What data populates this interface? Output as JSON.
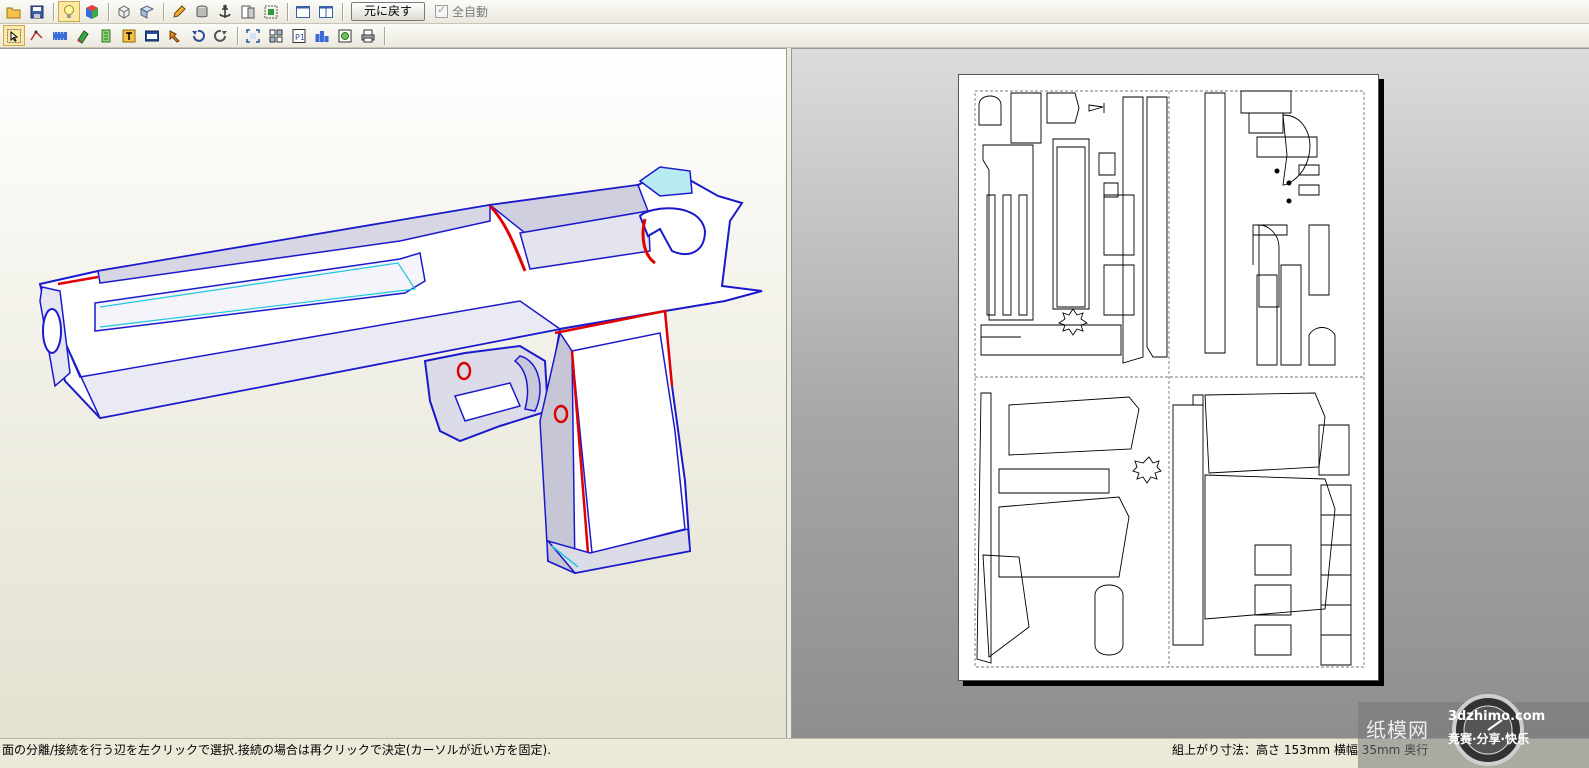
{
  "toolbar_top": {
    "icons": [
      "open-folder-icon",
      "save-disk-icon",
      "lightbulb-icon",
      "color-cube-icon",
      "cube-outline-icon",
      "cube-flat-icon",
      "pencil-icon",
      "cylinder-icon",
      "anchor-icon",
      "page-split-icon",
      "green-box-icon",
      "single-pane-icon",
      "dual-pane-icon"
    ],
    "undo_label": "元に戻す",
    "auto_label": "全自動",
    "auto_checked": true
  },
  "toolbar_bottom": {
    "icons": [
      "select-arrow-icon",
      "join-edge-icon",
      "film-strip-icon",
      "rotate-parts-icon",
      "glue-tab-icon",
      "text-label-icon",
      "image-icon",
      "move-parts-icon",
      "undo-arrow-icon",
      "redo-arrow-icon",
      "fit-frame-icon",
      "arrange-parts-icon",
      "page-number-icon",
      "layout-grid-icon",
      "texture-icon",
      "print-icon"
    ]
  },
  "status": {
    "left_text": "面の分離/接続を行う辺を左クリックで選択.接続の場合は再クリックで決定(カーソルが近い方を固定).",
    "right_text": "組上がり寸法：高さ 153mm 横幅 35mm 奥行"
  },
  "watermark": {
    "cn": "纸模网",
    "en": "3dzhimo.com",
    "sub": "竞赛·分享·快乐"
  },
  "colors": {
    "accent_red": "#e00000",
    "edge_blue": "#1a1acc",
    "edge_cyan": "#20c8e0"
  }
}
